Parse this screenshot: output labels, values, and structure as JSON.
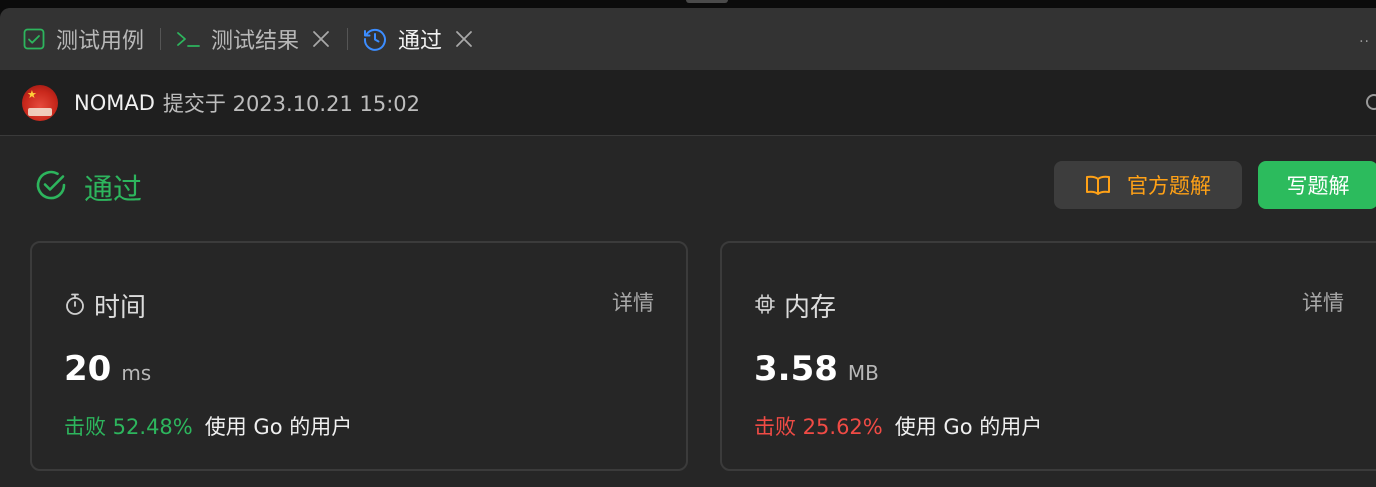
{
  "tabs": [
    {
      "label": "测试用例",
      "icon": "checkbox-icon",
      "closable": false
    },
    {
      "label": "测试结果",
      "icon": "terminal-icon",
      "closable": true
    },
    {
      "label": "通过",
      "icon": "history-icon",
      "closable": true,
      "active": true
    }
  ],
  "submission": {
    "user": "NOMAD",
    "submitted_text": "提交于 2023.10.21 15:02"
  },
  "status": {
    "label": "通过",
    "color": "#2db55d"
  },
  "actions": {
    "official_solution": "官方题解",
    "write_solution": "写题解"
  },
  "cards": {
    "time": {
      "title": "时间",
      "detail": "详情",
      "value": "20",
      "unit": "ms",
      "beats_pct": "击败 52.48%",
      "beats_rest": "使用 Go 的用户",
      "pct_color": "#2db55d"
    },
    "memory": {
      "title": "内存",
      "detail": "详情",
      "value": "3.58",
      "unit": "MB",
      "beats_pct": "击败 25.62%",
      "beats_rest": "使用 Go 的用户",
      "pct_color": "#f04b45"
    }
  }
}
